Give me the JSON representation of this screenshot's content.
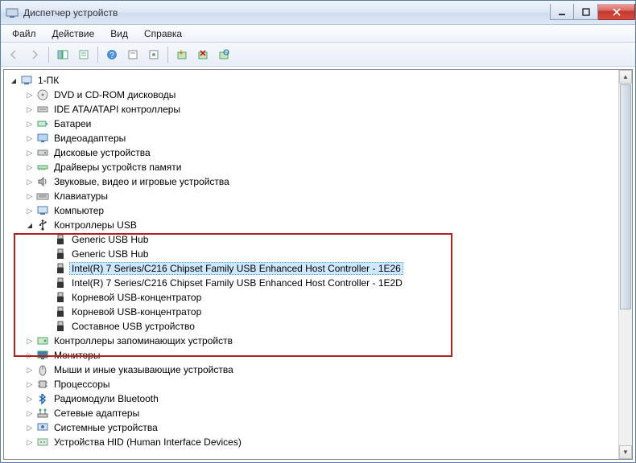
{
  "window": {
    "title": "Диспетчер устройств"
  },
  "menu": {
    "file": "Файл",
    "action": "Действие",
    "view": "Вид",
    "help": "Справка"
  },
  "tree": {
    "root": "1-ПК",
    "categories": [
      {
        "label": "DVD и CD-ROM дисководы",
        "icon": "disc"
      },
      {
        "label": "IDE ATA/ATAPI контроллеры",
        "icon": "ide"
      },
      {
        "label": "Батареи",
        "icon": "battery"
      },
      {
        "label": "Видеоадаптеры",
        "icon": "display"
      },
      {
        "label": "Дисковые устройства",
        "icon": "disk"
      },
      {
        "label": "Драйверы устройств памяти",
        "icon": "mem"
      },
      {
        "label": "Звуковые, видео и игровые устройства",
        "icon": "sound"
      },
      {
        "label": "Клавиатуры",
        "icon": "keyboard"
      },
      {
        "label": "Компьютер",
        "icon": "computer"
      },
      {
        "label": "Контроллеры USB",
        "icon": "usb",
        "expanded": true,
        "children": [
          "Generic USB Hub",
          "Generic USB Hub",
          "Intel(R) 7 Series/C216 Chipset Family USB Enhanced Host Controller - 1E26",
          "Intel(R) 7 Series/C216 Chipset Family USB Enhanced Host Controller - 1E2D",
          "Корневой USB-концентратор",
          "Корневой USB-концентратор",
          "Составное USB устройство"
        ],
        "selected_index": 2
      },
      {
        "label": "Контроллеры запоминающих устройств",
        "icon": "storage"
      },
      {
        "label": "Мониторы",
        "icon": "monitor"
      },
      {
        "label": "Мыши и иные указывающие устройства",
        "icon": "mouse"
      },
      {
        "label": "Процессоры",
        "icon": "cpu"
      },
      {
        "label": "Радиомодули Bluetooth",
        "icon": "bluetooth"
      },
      {
        "label": "Сетевые адаптеры",
        "icon": "network"
      },
      {
        "label": "Системные устройства",
        "icon": "system"
      },
      {
        "label": "Устройства HID (Human Interface Devices)",
        "icon": "hid"
      }
    ]
  }
}
